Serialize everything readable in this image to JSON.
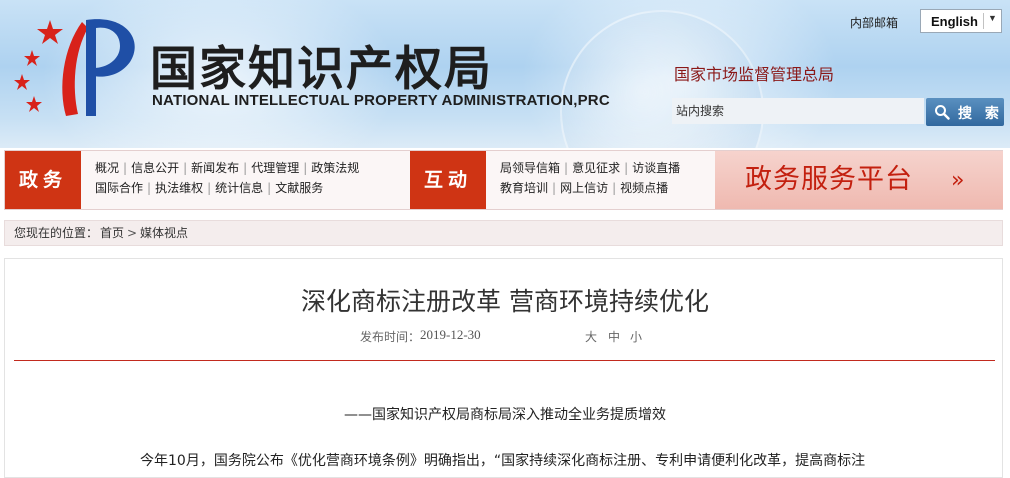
{
  "header": {
    "org_name_cn": "国家知识产权局",
    "org_name_en": "NATIONAL INTELLECTUAL PROPERTY ADMINISTRATION,PRC",
    "mail_link": "内部邮箱",
    "language": "English",
    "parent_org_link": "国家市场监督管理总局",
    "search": {
      "placeholder": "站内搜索",
      "button": "搜 索",
      "icon": "magnifier-icon"
    }
  },
  "nav": {
    "gov_affairs": {
      "label": "政务",
      "row1": [
        "概况",
        "信息公开",
        "新闻发布",
        "代理管理",
        "政策法规"
      ],
      "row2": [
        "国际合作",
        "执法维权",
        "统计信息",
        "文献服务"
      ]
    },
    "interaction": {
      "label": "互动",
      "row1": [
        "局领导信箱",
        "意见征求",
        "访谈直播"
      ],
      "row2": [
        "教育培训",
        "网上信访",
        "视频点播"
      ]
    },
    "platform": {
      "label": "政务服务平台",
      "chevron": "»"
    }
  },
  "breadcrumb": {
    "label": "您现在的位置：",
    "home": "首页",
    "separator": ">",
    "current": "媒体视点"
  },
  "article": {
    "title": "深化商标注册改革 营商环境持续优化",
    "date_label": "发布时间：",
    "date": "2019-12-30",
    "font_sizes": [
      "大",
      "中",
      "小"
    ],
    "subtitle": "——国家知识产权局商标局深入推动全业务提质增效",
    "paragraph": "今年10月，国务院公布《优化营商环境条例》明确指出，“国家持续深化商标注册、专利申请便利化改革，提高商标注"
  },
  "colors": {
    "accent_red": "#cf3414",
    "platform_red": "#c3200f",
    "divider_red": "#c22a1e",
    "search_blue": "#31689e"
  }
}
